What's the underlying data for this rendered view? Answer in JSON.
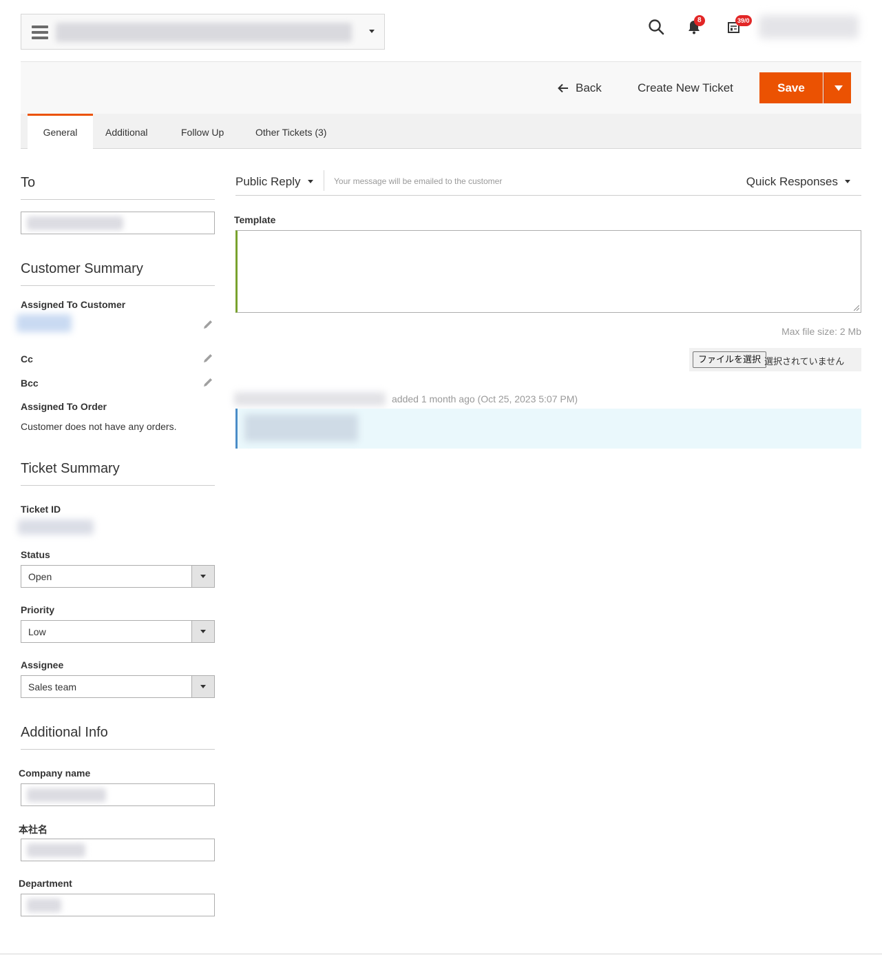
{
  "header": {
    "notifications_count": "8",
    "messages_count": "39/0"
  },
  "actions": {
    "back_label": "Back",
    "create_label": "Create New Ticket",
    "save_label": "Save"
  },
  "tabs": [
    {
      "label": "General",
      "active": true
    },
    {
      "label": "Additional",
      "active": false
    },
    {
      "label": "Follow Up",
      "active": false
    },
    {
      "label": "Other Tickets (3)",
      "active": false
    }
  ],
  "left": {
    "to_title": "To",
    "customer_summary_title": "Customer Summary",
    "assigned_customer_label": "Assigned To Customer",
    "cc_label": "Cc",
    "bcc_label": "Bcc",
    "assigned_order_label": "Assigned To Order",
    "no_orders_text": "Customer does not have any orders.",
    "ticket_summary_title": "Ticket Summary",
    "ticket_id_label": "Ticket ID",
    "status_label": "Status",
    "status_value": "Open",
    "priority_label": "Priority",
    "priority_value": "Low",
    "assignee_label": "Assignee",
    "assignee_value": "Sales team",
    "additional_info_title": "Additional Info",
    "company_label": "Company name",
    "hq_label": "本社名",
    "department_label": "Department"
  },
  "reply": {
    "type_label": "Public Reply",
    "hint": "Your message will be emailed to the customer",
    "quick_responses_label": "Quick Responses",
    "template_label": "Template",
    "max_file_size": "Max file size: 2 Mb",
    "file_button_label": "ファイルを選択",
    "file_none_text": "選択されていません"
  },
  "history": {
    "meta": "added 1 month ago (Oct 25, 2023 5:07 PM)"
  },
  "colors": {
    "accent": "#eb5202",
    "badge": "#e22626",
    "template_border": "#79a22e",
    "message_bg": "#eaf8fc"
  }
}
